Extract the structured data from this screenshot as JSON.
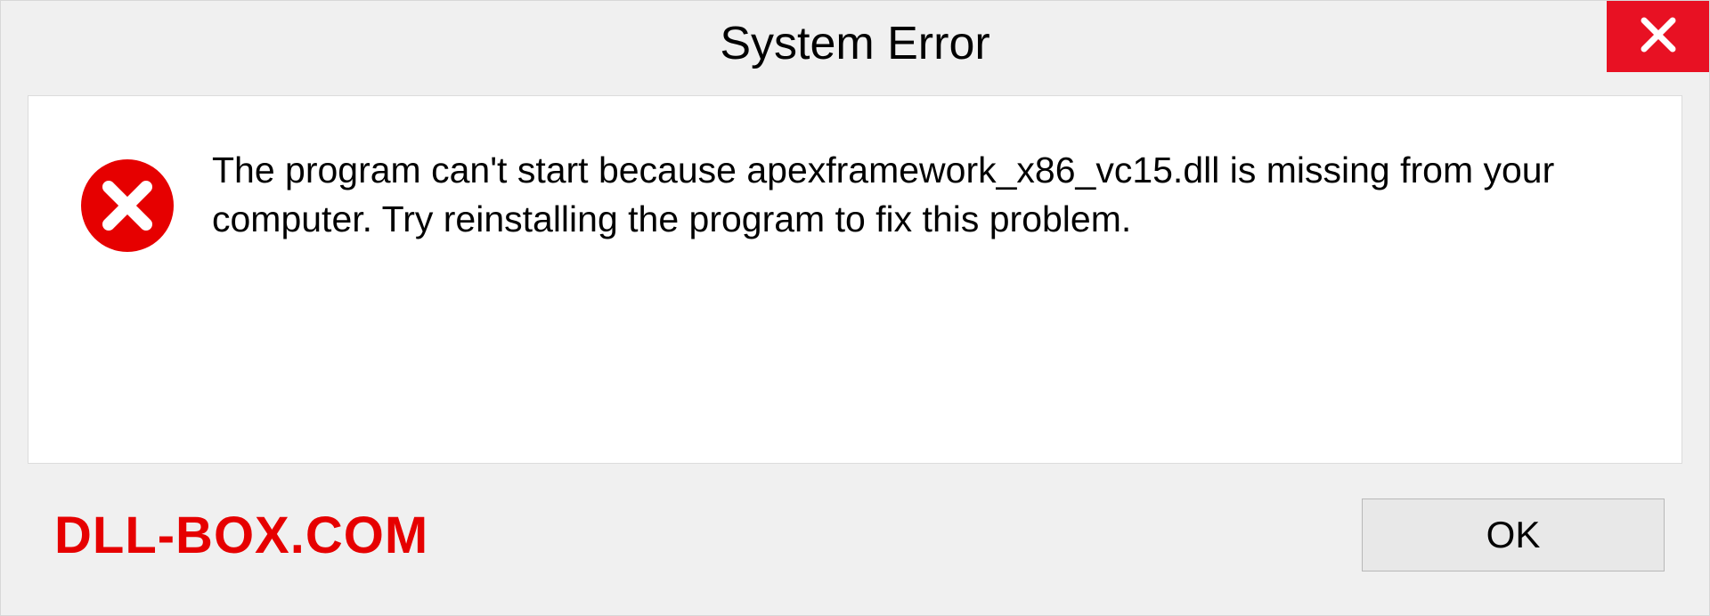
{
  "titlebar": {
    "title": "System Error"
  },
  "content": {
    "message": "The program can't start because apexframework_x86_vc15.dll is missing from your computer. Try reinstalling the program to fix this problem."
  },
  "footer": {
    "watermark": "DLL-BOX.COM",
    "ok_label": "OK"
  }
}
